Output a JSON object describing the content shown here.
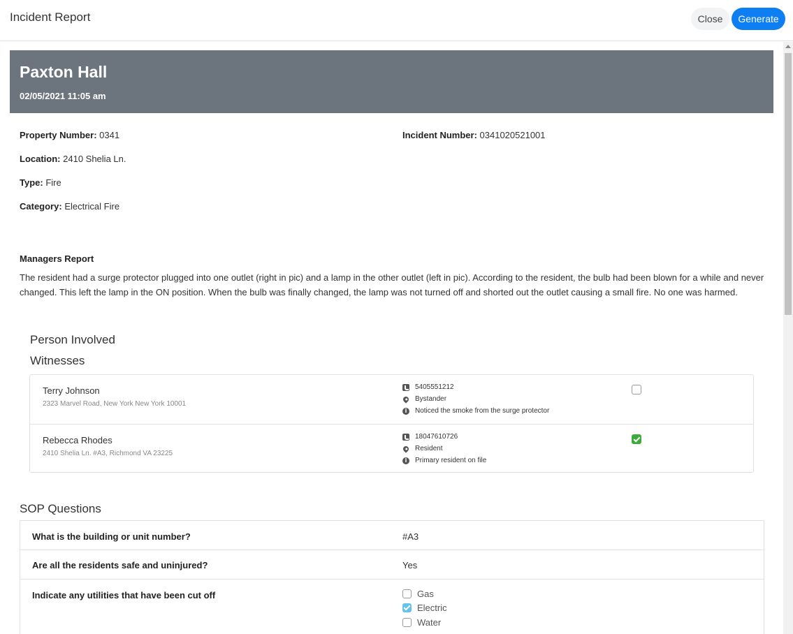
{
  "modal": {
    "title": "Incident Report",
    "close_label": "Close",
    "generate_label": "Generate"
  },
  "banner": {
    "property_name": "Paxton Hall",
    "datetime": "02/05/2021 11:05 am",
    "background_color": "#6c757d"
  },
  "details": {
    "property_number_label": "Property Number:",
    "property_number": "0341",
    "incident_number_label": "Incident Number:",
    "incident_number": "0341020521001",
    "location_label": "Location:",
    "location": "2410 Shelia Ln.",
    "type_label": "Type:",
    "type": "Fire",
    "category_label": "Category:",
    "category": "Electrical Fire"
  },
  "managers_report": {
    "heading": "Managers Report",
    "text": "The resident had a surge protector plugged into one outlet (right in pic) and a lamp in the other outlet (left in pic). According to the resident, the bulb had been blown for a while and never changed. This left the lamp in the ON position. When the bulb was finally changed, the lamp was not turned off and shorted out the outlet causing a small fire. No one was harmed."
  },
  "persons": {
    "heading": "Person Involved",
    "witnesses_heading": "Witnesses",
    "witnesses": [
      {
        "name": "Terry Johnson",
        "address": "2323 Marvel Road, New York New York 10001",
        "phone": "5405551212",
        "role": "Bystander",
        "note": "Noticed the smoke from the surge protector",
        "checked": false,
        "phone_icon": "phone-icon",
        "role_icon": "map-marker-icon",
        "note_icon": "info-circle-icon"
      },
      {
        "name": "Rebecca Rhodes",
        "address": "2410 Shelia Ln. #A3, Richmond VA 23225",
        "phone": "18047610726",
        "role": "Resident",
        "note": "Primary resident on file",
        "checked": true,
        "phone_icon": "phone-icon",
        "role_icon": "map-marker-icon",
        "note_icon": "info-circle-icon"
      }
    ]
  },
  "sop": {
    "heading": "SOP Questions",
    "questions": [
      {
        "question": "What is the building or unit number?",
        "answer": "#A3"
      },
      {
        "question": "Are all the residents safe and uninjured?",
        "answer": "Yes"
      },
      {
        "question": "Indicate any utilities that have been cut off",
        "options": [
          {
            "label": "Gas",
            "checked": false
          },
          {
            "label": "Electric",
            "checked": true
          },
          {
            "label": "Water",
            "checked": false
          }
        ]
      }
    ]
  },
  "colors": {
    "primary_button": "#0d7ff2",
    "witness_checked": "#3cab3b",
    "utility_checked": "#63c3e8"
  }
}
